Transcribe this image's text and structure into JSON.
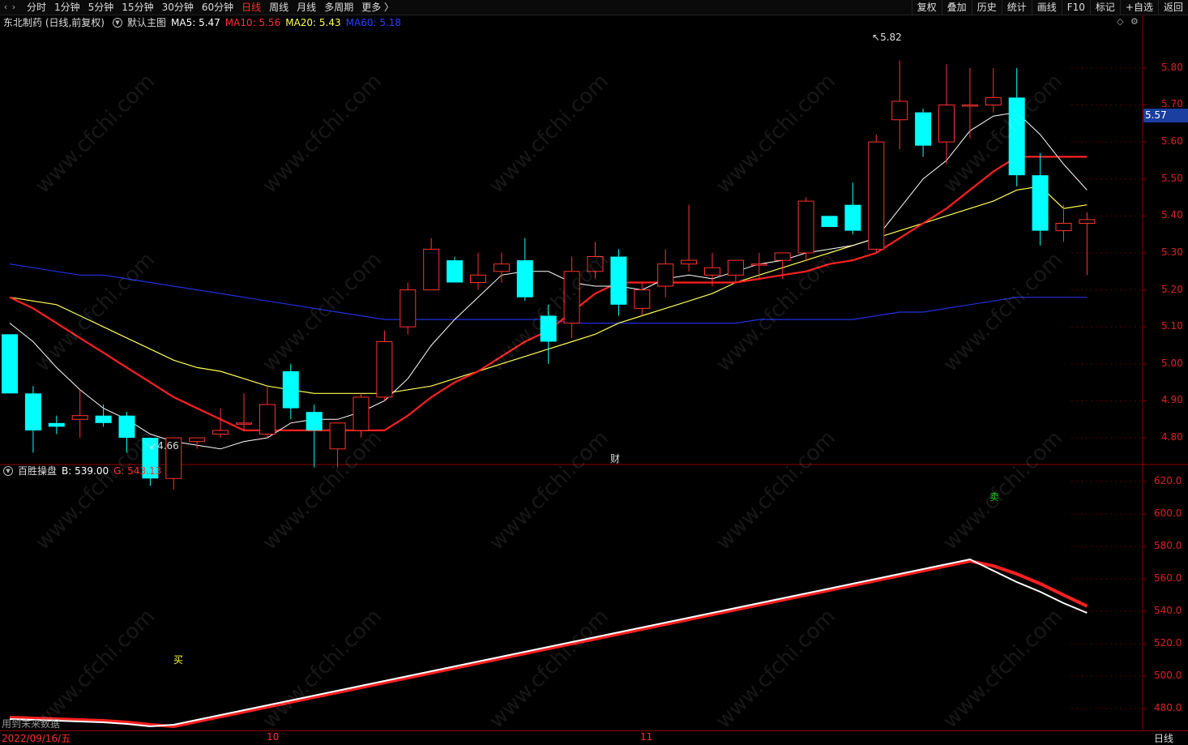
{
  "toolbar": {
    "periods": [
      "分时",
      "1分钟",
      "5分钟",
      "15分钟",
      "30分钟",
      "60分钟",
      "日线",
      "周线",
      "月线",
      "多周期",
      "更多 〉"
    ],
    "active_period": "日线",
    "right_buttons": [
      "复权",
      "叠加",
      "历史",
      "统计",
      "画线",
      "F10",
      "标记",
      "+自选",
      "返回"
    ]
  },
  "main_info": {
    "stock": "东北制药 (日线,前复权)",
    "template": "默认主图",
    "ma5": "MA5: 5.47",
    "ma10": "MA10: 5.56",
    "ma20": "MA20: 5.43",
    "ma60": "MA60: 5.18"
  },
  "sub_info": {
    "name": "百胜操盘",
    "b": "B: 539.00",
    "g": "G: 543.13"
  },
  "price_axis": [
    "5.80",
    "5.70",
    "5.60",
    "5.50",
    "5.40",
    "5.30",
    "5.20",
    "5.10",
    "5.00",
    "4.90",
    "4.80"
  ],
  "price_axis_values": [
    5.8,
    5.7,
    5.6,
    5.5,
    5.4,
    5.3,
    5.2,
    5.1,
    5.0,
    4.9,
    4.8
  ],
  "current_price": "5.57",
  "indicator_axis": [
    "620.0",
    "600.0",
    "580.0",
    "560.0",
    "540.0",
    "520.0",
    "500.0",
    "480.0"
  ],
  "indicator_axis_values": [
    620,
    600,
    580,
    560,
    540,
    520,
    500,
    480
  ],
  "high_label": "5.82",
  "low_label": "4.66",
  "event_marker": "财",
  "buy_marker": "买",
  "sell_marker": "卖",
  "footer_note": "用到未来数据",
  "x_axis": [
    "2022/09/16/五",
    "10",
    "11"
  ],
  "period_label": "日线",
  "watermark": "www.cfchi.com",
  "colors": {
    "up": "#ff3232",
    "down": "#00ffff",
    "ma5": "#ffffff",
    "ma10": "#ff2020",
    "ma20": "#ffff50",
    "ma60": "#2030e0",
    "price_tag_bg": "#1b3fa0"
  },
  "chart_data": {
    "type": "candlestick",
    "candles": [
      {
        "o": 5.08,
        "h": 5.08,
        "l": 4.92,
        "c": 4.92
      },
      {
        "o": 4.92,
        "h": 4.94,
        "l": 4.76,
        "c": 4.82
      },
      {
        "o": 4.84,
        "h": 4.86,
        "l": 4.81,
        "c": 4.83
      },
      {
        "o": 4.85,
        "h": 4.93,
        "l": 4.8,
        "c": 4.86
      },
      {
        "o": 4.86,
        "h": 4.89,
        "l": 4.83,
        "c": 4.84
      },
      {
        "o": 4.86,
        "h": 4.87,
        "l": 4.76,
        "c": 4.8
      },
      {
        "o": 4.8,
        "h": 4.8,
        "l": 4.67,
        "c": 4.69
      },
      {
        "o": 4.69,
        "h": 4.8,
        "l": 4.66,
        "c": 4.8
      },
      {
        "o": 4.79,
        "h": 4.8,
        "l": 4.77,
        "c": 4.8
      },
      {
        "o": 4.81,
        "h": 4.88,
        "l": 4.8,
        "c": 4.82
      },
      {
        "o": 4.84,
        "h": 4.92,
        "l": 4.82,
        "c": 4.84
      },
      {
        "o": 4.81,
        "h": 4.94,
        "l": 4.8,
        "c": 4.89
      },
      {
        "o": 4.98,
        "h": 5.0,
        "l": 4.85,
        "c": 4.88
      },
      {
        "o": 4.87,
        "h": 4.89,
        "l": 4.72,
        "c": 4.82
      },
      {
        "o": 4.77,
        "h": 4.84,
        "l": 4.72,
        "c": 4.84
      },
      {
        "o": 4.82,
        "h": 4.92,
        "l": 4.8,
        "c": 4.91
      },
      {
        "o": 4.91,
        "h": 5.09,
        "l": 4.9,
        "c": 5.06
      },
      {
        "o": 5.1,
        "h": 5.22,
        "l": 5.08,
        "c": 5.2
      },
      {
        "o": 5.2,
        "h": 5.34,
        "l": 5.2,
        "c": 5.31
      },
      {
        "o": 5.28,
        "h": 5.29,
        "l": 5.22,
        "c": 5.22
      },
      {
        "o": 5.22,
        "h": 5.3,
        "l": 5.2,
        "c": 5.24
      },
      {
        "o": 5.25,
        "h": 5.3,
        "l": 5.22,
        "c": 5.27
      },
      {
        "o": 5.28,
        "h": 5.34,
        "l": 5.17,
        "c": 5.18
      },
      {
        "o": 5.13,
        "h": 5.16,
        "l": 5.0,
        "c": 5.06
      },
      {
        "o": 5.11,
        "h": 5.29,
        "l": 5.07,
        "c": 5.25
      },
      {
        "o": 5.25,
        "h": 5.33,
        "l": 5.23,
        "c": 5.29
      },
      {
        "o": 5.29,
        "h": 5.31,
        "l": 5.13,
        "c": 5.16
      },
      {
        "o": 5.15,
        "h": 5.22,
        "l": 5.13,
        "c": 5.2
      },
      {
        "o": 5.21,
        "h": 5.31,
        "l": 5.18,
        "c": 5.27
      },
      {
        "o": 5.27,
        "h": 5.43,
        "l": 5.25,
        "c": 5.28
      },
      {
        "o": 5.24,
        "h": 5.3,
        "l": 5.21,
        "c": 5.26
      },
      {
        "o": 5.24,
        "h": 5.28,
        "l": 5.22,
        "c": 5.28
      },
      {
        "o": 5.27,
        "h": 5.3,
        "l": 5.23,
        "c": 5.27
      },
      {
        "o": 5.28,
        "h": 5.3,
        "l": 5.23,
        "c": 5.3
      },
      {
        "o": 5.3,
        "h": 5.45,
        "l": 5.28,
        "c": 5.44
      },
      {
        "o": 5.4,
        "h": 5.4,
        "l": 5.37,
        "c": 5.37
      },
      {
        "o": 5.43,
        "h": 5.49,
        "l": 5.35,
        "c": 5.36
      },
      {
        "o": 5.31,
        "h": 5.62,
        "l": 5.3,
        "c": 5.6
      },
      {
        "o": 5.66,
        "h": 5.82,
        "l": 5.58,
        "c": 5.71
      },
      {
        "o": 5.68,
        "h": 5.69,
        "l": 5.56,
        "c": 5.59
      },
      {
        "o": 5.6,
        "h": 5.81,
        "l": 5.54,
        "c": 5.7
      },
      {
        "o": 5.7,
        "h": 5.8,
        "l": 5.61,
        "c": 5.7
      },
      {
        "o": 5.7,
        "h": 5.8,
        "l": 5.68,
        "c": 5.72
      },
      {
        "o": 5.72,
        "h": 5.8,
        "l": 5.48,
        "c": 5.51
      },
      {
        "o": 5.51,
        "h": 5.57,
        "l": 5.32,
        "c": 5.36
      },
      {
        "o": 5.36,
        "h": 5.43,
        "l": 5.33,
        "c": 5.38
      },
      {
        "o": 5.38,
        "h": 5.41,
        "l": 5.24,
        "c": 5.39
      }
    ],
    "ma5": [
      5.11,
      5.06,
      4.99,
      4.93,
      4.88,
      4.85,
      4.81,
      4.79,
      4.78,
      4.77,
      4.79,
      4.8,
      4.84,
      4.85,
      4.85,
      4.87,
      4.9,
      4.96,
      5.05,
      5.12,
      5.18,
      5.24,
      5.25,
      5.25,
      5.22,
      5.21,
      5.21,
      5.2,
      5.23,
      5.24,
      5.23,
      5.25,
      5.27,
      5.28,
      5.3,
      5.31,
      5.32,
      5.34,
      5.42,
      5.5,
      5.55,
      5.63,
      5.67,
      5.68,
      5.62,
      5.54,
      5.47
    ],
    "ma10": [
      5.18,
      5.15,
      5.11,
      5.07,
      5.03,
      4.99,
      4.95,
      4.91,
      4.88,
      4.85,
      4.82,
      4.82,
      4.82,
      4.82,
      4.82,
      4.82,
      4.82,
      4.86,
      4.91,
      4.95,
      4.98,
      5.02,
      5.06,
      5.09,
      5.14,
      5.19,
      5.22,
      5.22,
      5.22,
      5.22,
      5.22,
      5.22,
      5.23,
      5.24,
      5.25,
      5.27,
      5.28,
      5.3,
      5.34,
      5.38,
      5.42,
      5.47,
      5.52,
      5.56,
      5.56,
      5.56,
      5.56
    ],
    "ma20": [
      5.18,
      5.17,
      5.16,
      5.13,
      5.1,
      5.07,
      5.04,
      5.01,
      4.99,
      4.98,
      4.96,
      4.94,
      4.93,
      4.92,
      4.92,
      4.92,
      4.92,
      4.93,
      4.94,
      4.96,
      4.98,
      5.0,
      5.02,
      5.04,
      5.06,
      5.08,
      5.11,
      5.13,
      5.15,
      5.17,
      5.19,
      5.22,
      5.24,
      5.26,
      5.28,
      5.3,
      5.32,
      5.34,
      5.36,
      5.38,
      5.4,
      5.42,
      5.44,
      5.47,
      5.48,
      5.42,
      5.43
    ],
    "ma60": [
      5.27,
      5.26,
      5.25,
      5.24,
      5.24,
      5.23,
      5.22,
      5.21,
      5.2,
      5.19,
      5.18,
      5.17,
      5.16,
      5.15,
      5.14,
      5.13,
      5.12,
      5.12,
      5.12,
      5.12,
      5.12,
      5.12,
      5.12,
      5.12,
      5.11,
      5.11,
      5.11,
      5.11,
      5.11,
      5.11,
      5.11,
      5.11,
      5.12,
      5.12,
      5.12,
      5.12,
      5.12,
      5.13,
      5.14,
      5.14,
      5.15,
      5.16,
      5.17,
      5.18,
      5.18,
      5.18,
      5.18
    ],
    "indicator": {
      "g": [
        474.5,
        474.0,
        473.5,
        473.0,
        472.5,
        471.5,
        470.0,
        469.0,
        472.0,
        475.0,
        478.0,
        481.0,
        484.0,
        487.0,
        490.0,
        493.0,
        496.0,
        499.0,
        502.0,
        505.0,
        508.0,
        511.0,
        514.0,
        517.0,
        520.0,
        523.0,
        526.0,
        529.0,
        532.0,
        535.0,
        538.0,
        541.0,
        544.0,
        547.0,
        550.0,
        553.0,
        556.0,
        559.0,
        562.0,
        565.0,
        568.0,
        571.0,
        568.0,
        563.0,
        557.0,
        550.0,
        543.13
      ],
      "b": [
        473.5,
        473.0,
        472.5,
        472.0,
        471.5,
        470.5,
        469.0,
        470.0,
        473.0,
        476.0,
        479.0,
        482.0,
        485.0,
        488.0,
        491.0,
        494.0,
        497.0,
        500.0,
        503.0,
        506.0,
        509.0,
        512.0,
        515.0,
        518.0,
        521.0,
        524.0,
        527.0,
        530.0,
        533.0,
        536.0,
        539.0,
        542.0,
        545.0,
        548.0,
        551.0,
        554.0,
        557.0,
        560.0,
        563.0,
        566.0,
        569.0,
        572.0,
        565.0,
        558.0,
        552.0,
        545.0,
        539.0
      ]
    }
  }
}
